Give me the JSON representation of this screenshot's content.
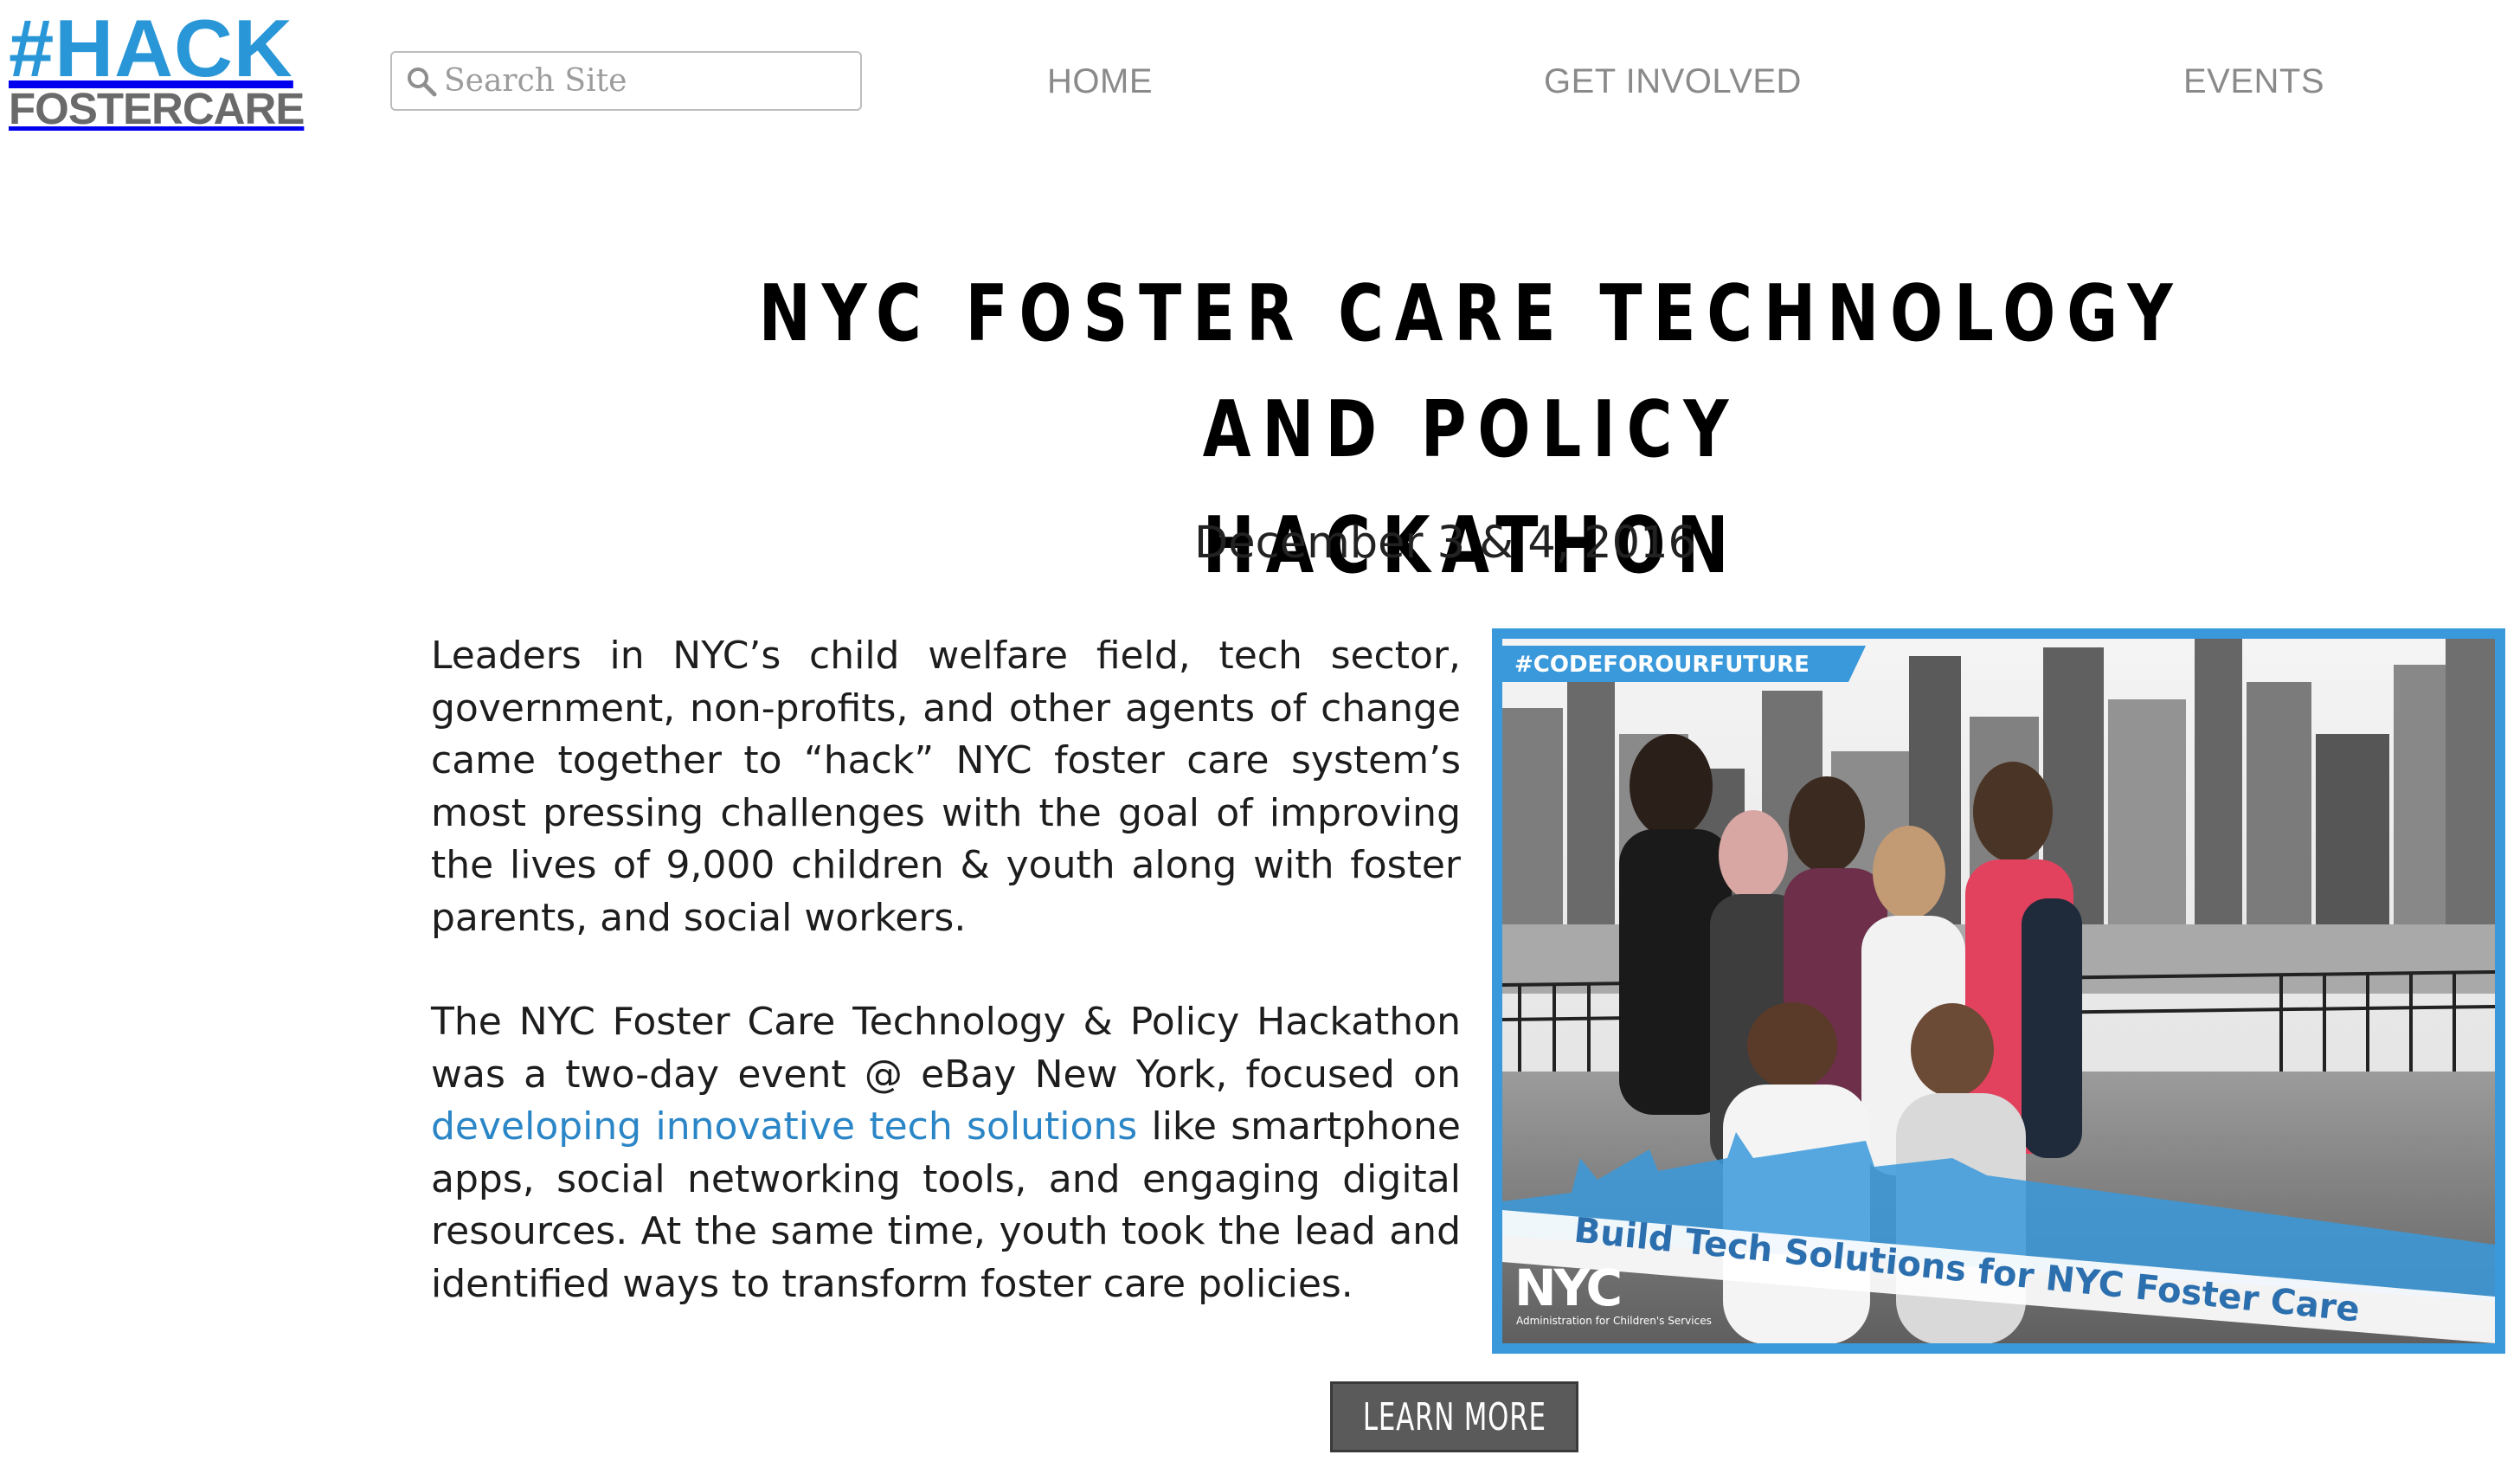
{
  "header": {
    "logo_line1": "#HACK",
    "logo_line2": "FOSTERCARE",
    "search_placeholder": "Search Site",
    "nav": [
      "HOME",
      "GET INVOLVED",
      "EVENTS"
    ]
  },
  "main": {
    "title_line1": "NYC FOSTER CARE TECHNOLOGY AND POLICY",
    "title_line2": "HACKATHON",
    "date": "December 3 & 4, 2016",
    "paragraph1": "Leaders in NYC’s child welfare field, tech sector, government, non-profits, and other agents of change came together to “hack” NYC foster care system’s most pressing challenges with the goal of improving the lives of 9,000 children & youth along with foster parents, and social workers.",
    "paragraph2_before": "The NYC Foster Care Technology & Policy Hackathon was a two-day event @ eBay New York, focused on ",
    "paragraph2_link": "developing innovative tech solutions",
    "paragraph2_after": " like smartphone apps, social networking tools, and engaging digital resources. At the same time, youth took the lead and identified ways to transform foster care policies.",
    "learn_more": "LEARN MORE"
  },
  "hero": {
    "hashtag": "#CODEFOROURFUTURE",
    "banner": "Build Tech Solutions for NYC Foster Care",
    "agency_logo": "NYC",
    "agency_caption": "Administration for Children's Services"
  },
  "colors": {
    "brand_blue": "#2997d7",
    "logo_gray": "#6a6a6a",
    "nav_gray": "#8a8a8a",
    "link_blue": "#2b86c7",
    "button_gray": "#5a5a5a",
    "hero_border": "#3a99db"
  },
  "icons": {
    "search": "magnifier-icon"
  }
}
